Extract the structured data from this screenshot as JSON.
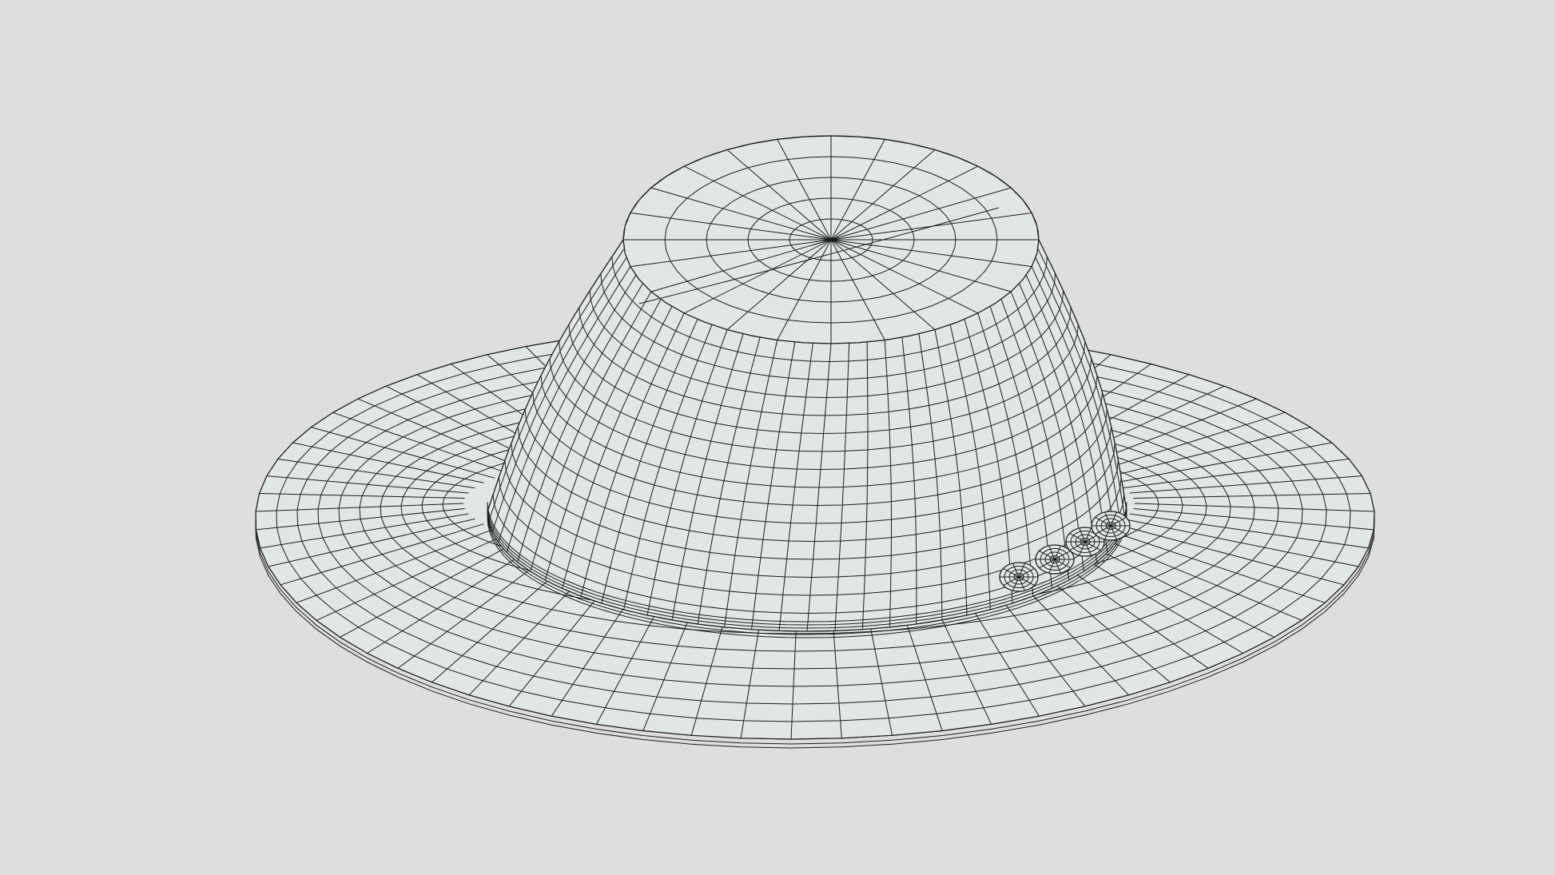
{
  "scene": {
    "subject": "hat",
    "render_mode": "wireframe",
    "background_color": "#dedede",
    "surface_color": "#e1e6e6",
    "wire_color": "#1c1c1c"
  }
}
